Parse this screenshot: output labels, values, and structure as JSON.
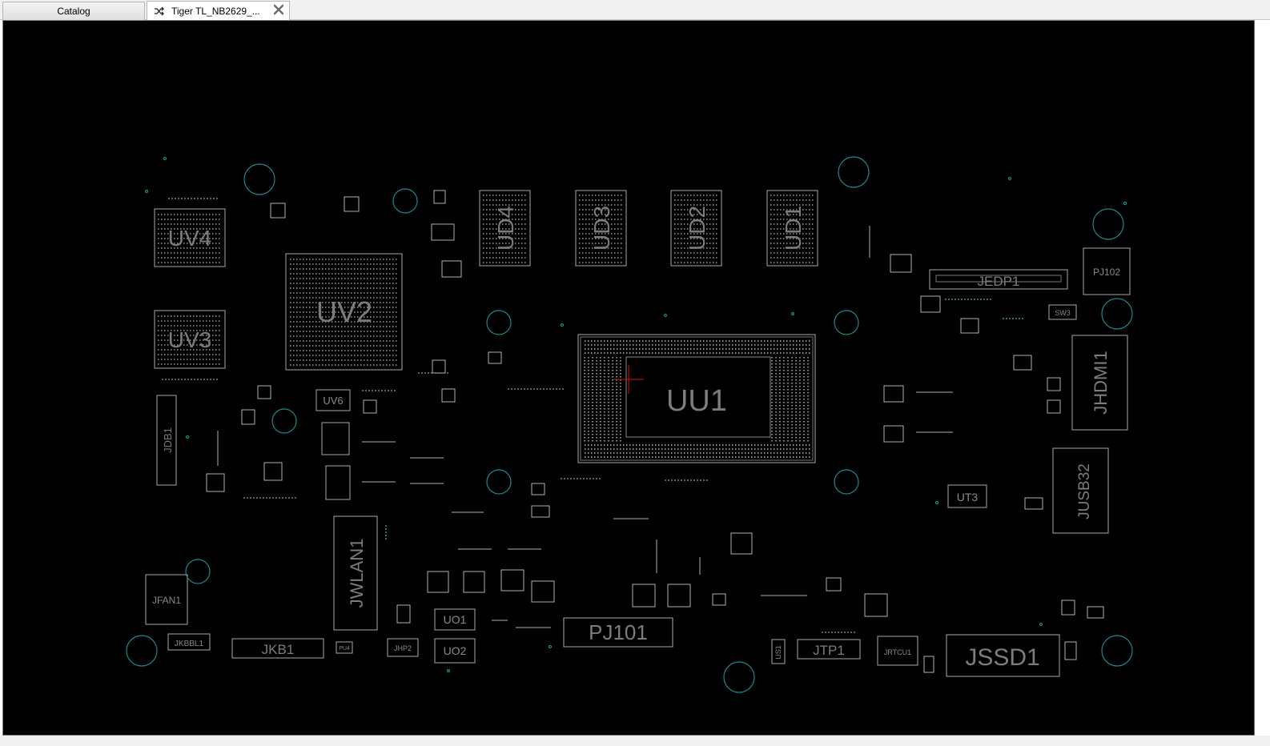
{
  "tabs": [
    {
      "label": "Catalog",
      "active": false
    },
    {
      "label": "Tiger TL_NB2629_...",
      "active": true
    }
  ],
  "icons": {
    "shuffle": "shuffle-icon",
    "close": "close-icon"
  },
  "colors": {
    "canvas_bg": "#000000",
    "outline": "#a8a8a8",
    "via": "#1b8a8a",
    "cursor": "#d01010"
  },
  "board": {
    "big_labels": {
      "uu1": "UU1",
      "uv2": "UV2",
      "uv4": "UV4",
      "uv3": "UV3",
      "ud1": "UD1",
      "ud2": "UD2",
      "ud3": "UD3",
      "ud4": "UD4",
      "jedp1": "JEDP1",
      "jhdmi1": "JHDMI1",
      "jusb32": "JUSB32",
      "jwlan1": "JWLAN1",
      "pj101": "PJ101",
      "jssd1": "JSSD1",
      "jkb1": "JKB1",
      "jtp1": "JTP1",
      "jdb1": "JDB1"
    },
    "small_labels": {
      "pj102": "PJ102",
      "ut3": "UT3",
      "uo1": "UO1",
      "uo2": "UO2",
      "uv6": "UV6",
      "jfan1": "JFAN1",
      "jkbbl1": "JKBBL1",
      "jrtcu1": "JRTCU1",
      "sw3": "SW3",
      "us1": "US1",
      "jhp2": "JHP2",
      "pu4": "PU4"
    }
  }
}
